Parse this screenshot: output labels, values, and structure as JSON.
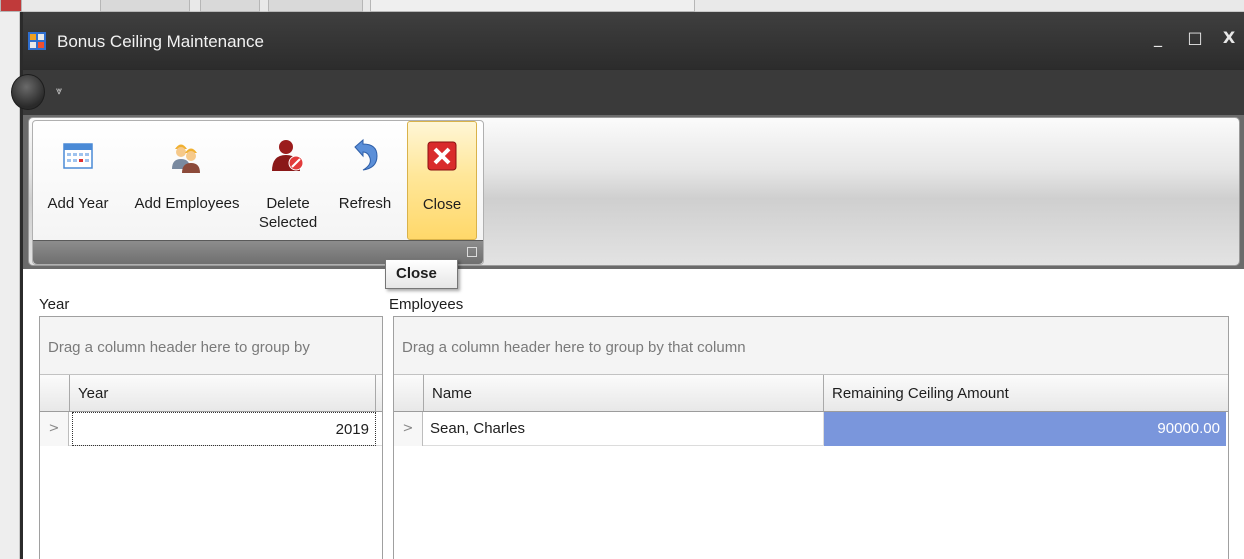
{
  "window": {
    "title": "Bonus Ceiling Maintenance",
    "controls": {
      "minimize": "_",
      "maximize": "□",
      "close": "X"
    }
  },
  "quick_access": {
    "customize_arrow": "⩔"
  },
  "ribbon": {
    "buttons": [
      {
        "label": "Add Year",
        "icon": "calendar-icon"
      },
      {
        "label": "Add Employees",
        "icon": "employees-icon"
      },
      {
        "label": "Delete\nSelected",
        "icon": "delete-user-icon"
      },
      {
        "label": "Refresh",
        "icon": "refresh-icon"
      },
      {
        "label": "Close",
        "icon": "close-icon"
      }
    ]
  },
  "tooltip": {
    "text": "Close"
  },
  "year_panel": {
    "label": "Year",
    "group_hint": "Drag a column header here to group by",
    "columns": [
      "Year"
    ],
    "rows": [
      {
        "year": "2019"
      }
    ]
  },
  "employee_panel": {
    "label": "Employees",
    "group_hint": "Drag a column header here to group by that column",
    "columns": [
      "Name",
      "Remaining Ceiling Amount"
    ],
    "rows": [
      {
        "name": "Sean, Charles",
        "remaining": "90000.00"
      }
    ]
  },
  "colors": {
    "selected_cell": "#7a96dc",
    "ribbon_active": "#ffd86a",
    "titlebar": "#333333"
  }
}
